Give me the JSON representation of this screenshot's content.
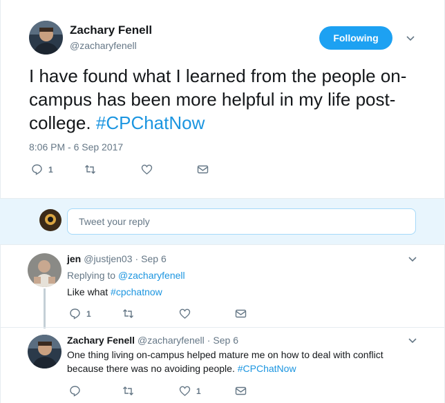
{
  "main_tweet": {
    "name": "Zachary Fenell",
    "handle": "@zacharyfenell",
    "follow_label": "Following",
    "text_pre": "I have found what I learned from the people on-campus has been more helpful in my life post-college.",
    "hashtag": "#CPChatNow",
    "timestamp": "8:06 PM - 6 Sep 2017",
    "reply_count": "1"
  },
  "reply_box": {
    "placeholder": "Tweet your reply"
  },
  "replies": [
    {
      "name": "jen",
      "handle": "@justjen03",
      "dot": "·",
      "date": "Sep 6",
      "replying_label": "Replying to",
      "replying_to": "@zacharyfenell",
      "text": "Like what",
      "hashtag": "#cpchatnow",
      "reply_count": "1"
    },
    {
      "name": "Zachary Fenell",
      "handle": "@zacharyfenell",
      "dot": "·",
      "date": "Sep 6",
      "text": "One thing living on-campus helped mature me on how to deal with conflict because there was no avoiding people.",
      "hashtag": "#CPChatNow",
      "like_count": "1"
    }
  ],
  "colors": {
    "accent": "#1da1f2",
    "link": "#1b95e0",
    "muted": "#657786",
    "reply_bg": "#e8f5fd"
  },
  "icons": [
    "reply-icon",
    "retweet-icon",
    "like-icon",
    "dm-icon",
    "chevron-down-icon"
  ]
}
